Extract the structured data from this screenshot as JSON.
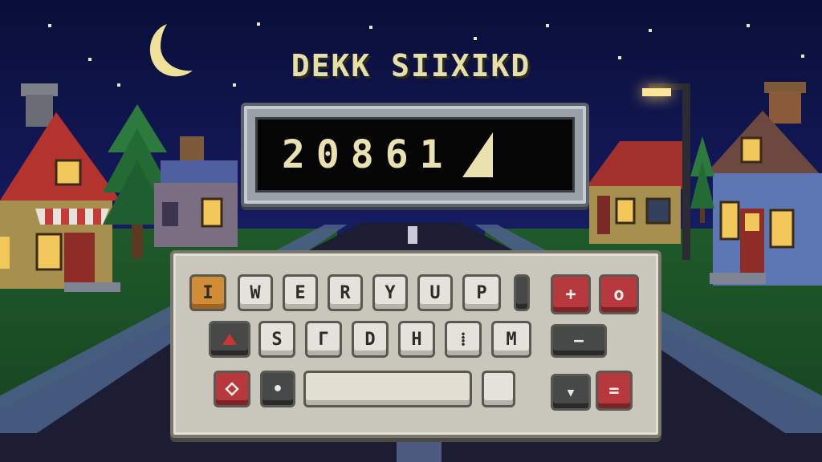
{
  "title": "DEKK SIIXIKD",
  "display": {
    "value": "20861"
  },
  "keyboard": {
    "row1": [
      "I",
      "W",
      "E",
      "R",
      "Y",
      "U",
      "P",
      ""
    ],
    "row2": [
      "",
      "S",
      "Γ",
      "D",
      "H",
      "⁞",
      "M"
    ],
    "row3_left": [
      "",
      "•"
    ],
    "right_keys": [
      "+",
      "o",
      "−",
      "▾",
      "="
    ]
  },
  "colors": {
    "accent": "#d18d35",
    "red_key": "#b8393d",
    "dark_key": "#474848",
    "screen_text": "#e9e2b0"
  }
}
